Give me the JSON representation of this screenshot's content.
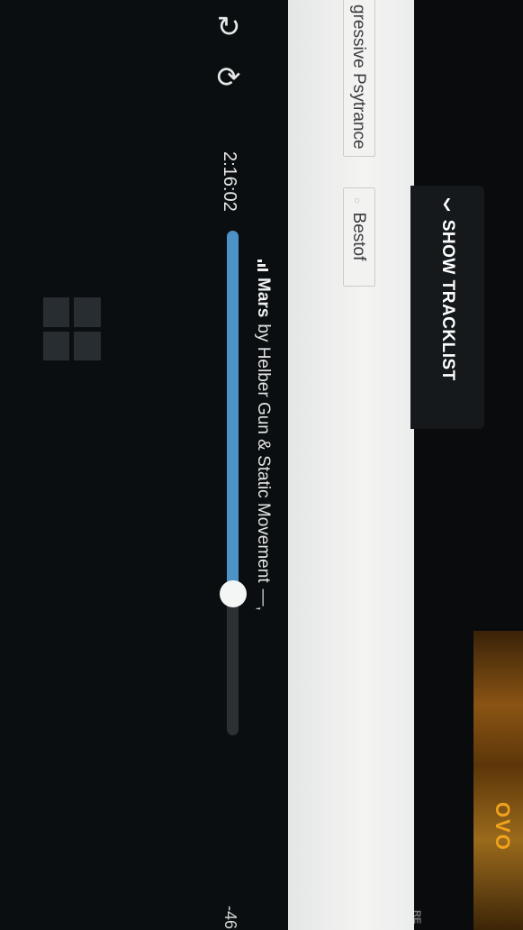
{
  "player": {
    "repeat_icon": "repeat-icon",
    "refresh_icon": "refresh-icon",
    "elapsed": "2:16:02",
    "remaining": "-46",
    "progress_percent": 72,
    "now_playing": {
      "title": "Mars",
      "by_artist": "by Helber Gun & Static Movement",
      "trailing": "—,"
    },
    "accent_color": "#4c92c6"
  },
  "tracklist_toggle": {
    "label": "SHOW TRACKLIST",
    "icon": "chevron-down-icon"
  },
  "tags": {
    "genre": "gressive Psytrance",
    "bestof": "Bestof"
  },
  "header": {
    "clipped_label": "RE"
  },
  "artwork": {
    "brand": "OVO"
  },
  "os": {
    "logo_icon": "windows-logo-icon"
  }
}
